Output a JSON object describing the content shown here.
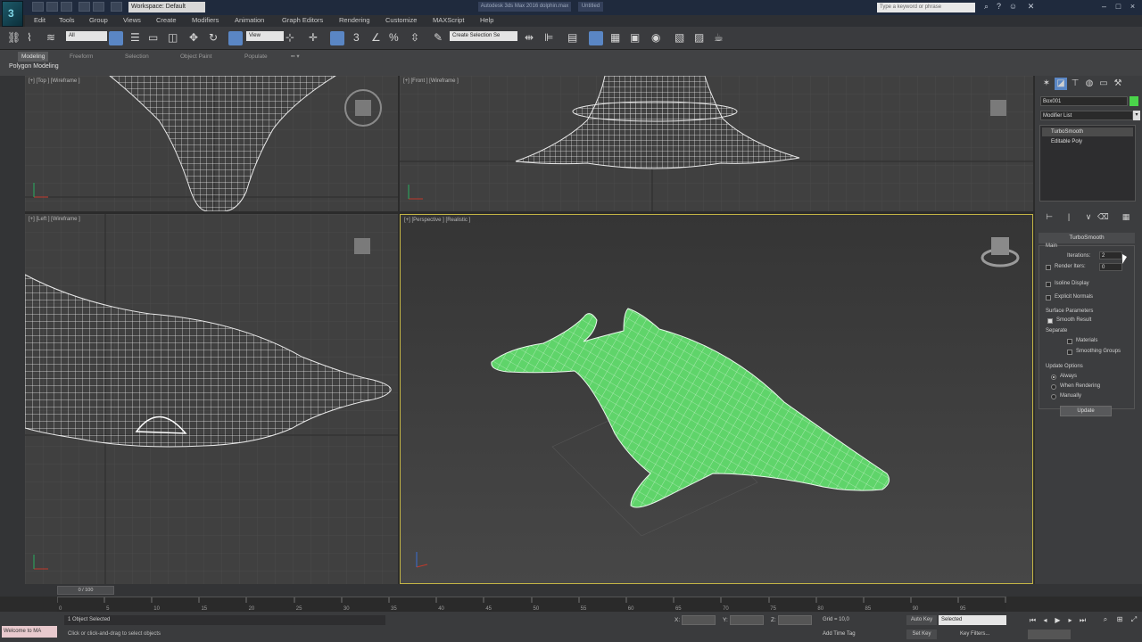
{
  "window": {
    "workspace": "Workspace: Default",
    "doc_title": "Autodesk 3ds Max 2016  dolphin.max",
    "doc_title_short": "Untitled",
    "search_placeholder": "Type a keyword or phrase"
  },
  "menu": [
    "Edit",
    "Tools",
    "Group",
    "Views",
    "Create",
    "Modifiers",
    "Animation",
    "Graph Editors",
    "Rendering",
    "Customize",
    "MAXScript",
    "Help"
  ],
  "toolbar": {
    "selection_filter": "All",
    "ref_coord": "View",
    "named_selection": "Create Selection Se"
  },
  "ribbon": {
    "tabs": [
      "Modeling",
      "Freeform",
      "Selection",
      "Object Paint",
      "Populate"
    ],
    "active_tab": "Modeling",
    "subtitle": "Polygon Modeling"
  },
  "viewports": {
    "top_label": "[+] [Top ] [Wireframe ]",
    "front_label": "[+] [Front ] [Wireframe ]",
    "left_label": "[+] [Left ] [Wireframe ]",
    "persp_label": "[+] [Perspective ] [Realistic ]"
  },
  "command_panel": {
    "object_name": "Box001",
    "object_color": "#4ad44a",
    "modifier_list": "Modifier List",
    "stack": [
      "TurboSmooth",
      "Editable Poly"
    ],
    "rollout_title": "TurboSmooth",
    "main_group": "Main",
    "iterations_label": "Iterations:",
    "iterations_value": "2",
    "render_iters_label": "Render Iters:",
    "render_iters_value": "0",
    "isoline_display": "Isoline Display",
    "explicit_normals": "Explicit Normals",
    "surface_params": "Surface Parameters",
    "smooth_result": "Smooth Result",
    "separate": "Separate",
    "materials": "Materials",
    "smoothing_groups": "Smoothing Groups",
    "update_options": "Update Options",
    "always": "Always",
    "when_rendering": "When Rendering",
    "manually": "Manually",
    "update_button": "Update"
  },
  "timeline": {
    "frame_display": "0 / 100",
    "ticks": [
      "0",
      "5",
      "10",
      "15",
      "20",
      "25",
      "30",
      "35",
      "40",
      "45",
      "50",
      "55",
      "60",
      "65",
      "70",
      "75",
      "80",
      "85",
      "90",
      "95",
      "100"
    ]
  },
  "status": {
    "maxscript": "Welcome to MA",
    "selection": "1 Object Selected",
    "prompt": "Click or click-and-drag to select objects",
    "x_label": "X:",
    "y_label": "Y:",
    "z_label": "Z:",
    "grid": "Grid = 10,0",
    "add_time_tag": "Add Time Tag",
    "auto_key": "Auto Key",
    "set_key": "Set Key",
    "key_mode": "Selected",
    "key_filters": "Key Filters...",
    "frame_value": "0"
  },
  "colors": {
    "dolphin_fill": "#5fd46a",
    "wire": "#e8e8e8",
    "active_border": "#c3b445",
    "accent": "#5a86c4"
  }
}
